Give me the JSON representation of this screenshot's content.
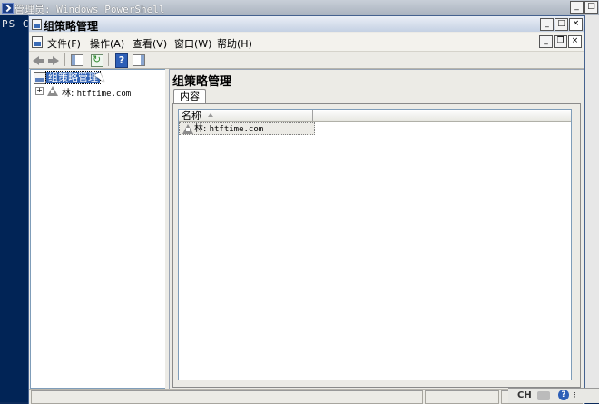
{
  "powershell": {
    "title": "管理员: Windows PowerShell",
    "prompt": "PS C"
  },
  "window": {
    "title": "组策略管理",
    "controls": {
      "minimize": "_",
      "maximize": "□",
      "close": "×"
    }
  },
  "menubar": {
    "items": [
      "文件(F)",
      "操作(A)",
      "查看(V)",
      "窗口(W)",
      "帮助(H)"
    ],
    "mdi_controls": {
      "minimize": "_",
      "restore": "❐",
      "close": "×"
    }
  },
  "toolbar": {
    "buttons": [
      "back-icon",
      "forward-icon",
      "show-hide-tree-icon",
      "refresh-icon",
      "help-icon",
      "action-pane-icon"
    ],
    "help_label": "?"
  },
  "tree": {
    "root": {
      "label": "组策略管理",
      "icon": "gpm-console-icon",
      "selected": true
    },
    "children": [
      {
        "expander": "+",
        "label": "林: ",
        "domain": "htftime.com",
        "icon": "forest-icon"
      }
    ]
  },
  "right_pane": {
    "title": "组策略管理",
    "tabs": [
      {
        "label": "内容",
        "active": true
      }
    ],
    "list": {
      "columns": [
        "名称",
        ""
      ],
      "rows": [
        {
          "label": "林: ",
          "domain": "htftime.com",
          "icon": "forest-icon"
        }
      ]
    }
  },
  "taskbar": {
    "language": "CH",
    "help_label": "?"
  }
}
